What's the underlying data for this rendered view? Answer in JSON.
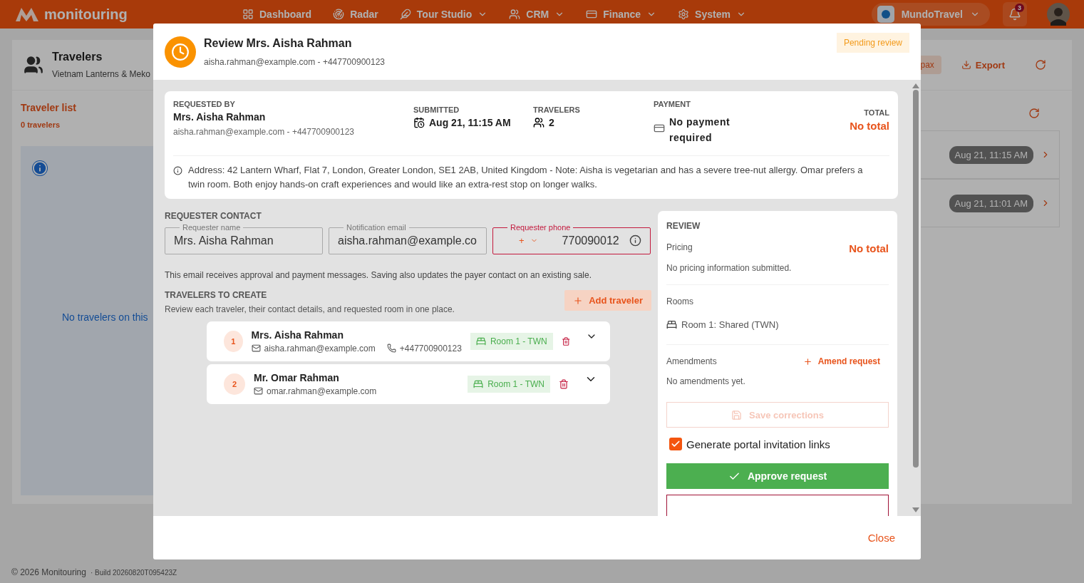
{
  "nav": {
    "logo": "monitouring",
    "items": [
      {
        "label": "Dashboard",
        "dropdown": false
      },
      {
        "label": "Radar",
        "dropdown": false
      },
      {
        "label": "Tour Studio",
        "dropdown": true
      },
      {
        "label": "CRM",
        "dropdown": true
      },
      {
        "label": "Finance",
        "dropdown": true
      },
      {
        "label": "System",
        "dropdown": true
      }
    ],
    "org": "MundoTravel",
    "notifications": "3"
  },
  "page": {
    "title": "Travelers",
    "subtitle": "Vietnam Lanterns & Meko",
    "pax": "pax",
    "export": "Export",
    "list_title": "Traveler list",
    "list_count": "0 travelers",
    "empty_text": "No travelers on this",
    "requests": [
      {
        "date": "Aug 21, 11:15 AM"
      },
      {
        "date": "Aug 21, 11:01 AM"
      }
    ]
  },
  "footer": {
    "copyright": "© 2026 Monitouring",
    "build": "· Build 20260820T095423Z"
  },
  "modal": {
    "title": "Review Mrs. Aisha Rahman",
    "subtitle": "aisha.rahman@example.com - +447700900123",
    "status": "Pending review",
    "summary": {
      "requested_by_label": "REQUESTED BY",
      "requester": "Mrs. Aisha Rahman",
      "requester_contact": "aisha.rahman@example.com - +447700900123",
      "submitted_label": "SUBMITTED",
      "submitted": "Aug 21, 11:15 AM",
      "travelers_label": "TRAVELERS",
      "travelers": "2",
      "payment_label": "PAYMENT",
      "payment": "No payment required",
      "total_label": "TOTAL",
      "total": "No total",
      "address": "Address: 42 Lantern Wharf, Flat 7, London, Greater London, SE1 2AB, United Kingdom - Note: Aisha is vegetarian and has a severe tree-nut allergy. Omar prefers a twin room. Both enjoy hands-on craft experiences and would like an extra-rest stop on longer walks."
    },
    "contact": {
      "title": "REQUESTER CONTACT",
      "fields": [
        {
          "kind": "text",
          "label": "Requester name",
          "value": "Mrs. Aisha Rahman",
          "error": false
        },
        {
          "kind": "text",
          "label": "Notification email",
          "value": "aisha.rahman@example.co",
          "error": false
        },
        {
          "kind": "phone",
          "label": "Requester phone",
          "prefix": "+",
          "value": "770090012",
          "error": true
        }
      ],
      "help": "This email receives approval and payment messages. Saving also updates the payer contact on an existing sale."
    },
    "travelers": {
      "title": "TRAVELERS TO CREATE",
      "subtitle": "Review each traveler, their contact details, and requested room in one place.",
      "add": "Add traveler",
      "items": [
        {
          "number": "1",
          "name": "Mrs. Aisha Rahman",
          "email": "aisha.rahman@example.com",
          "phone": "+447700900123",
          "room": "Room 1 - TWN",
          "expanded": false
        },
        {
          "number": "2",
          "name": "Mr. Omar Rahman",
          "email": "omar.rahman@example.com",
          "room": "Room 1 - TWN",
          "expanded": false
        }
      ]
    },
    "review": {
      "title": "REVIEW",
      "pricing_label": "Pricing",
      "pricing_total": "No total",
      "pricing_note": "No pricing information submitted.",
      "rooms_label": "Rooms",
      "room": "Room 1: Shared (TWN)",
      "amendments_label": "Amendments",
      "amend": "Amend request",
      "amendments_note": "No amendments yet.",
      "save": {
        "label": "Save corrections",
        "disabled": true
      },
      "portal_links": {
        "label": "Generate portal invitation links",
        "checked": true
      },
      "approve": "Approve request"
    },
    "close": "Close"
  }
}
